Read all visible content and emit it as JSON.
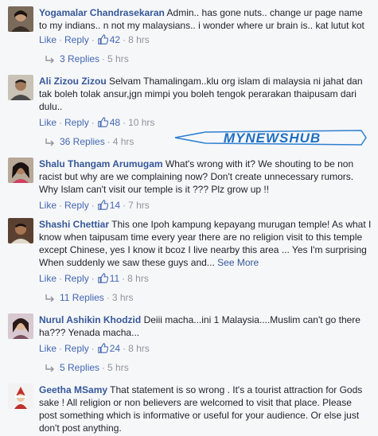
{
  "ui": {
    "like_label": "Like",
    "reply_label": "Reply",
    "like_icon": "thumbs-up-icon",
    "reply_arrow_icon": "reply-arrow-icon",
    "link_color": "#4267b2",
    "name_color": "#365899"
  },
  "watermark": {
    "text": "MYNEWSHUB"
  },
  "comments": [
    {
      "name": "Yogamalar Chandrasekaran",
      "text": "Admin.. has gone nuts.. change ur page name to my indians.. n not my malaysians.. i wonder where ur brain is.. kat lutut kot",
      "likes": "42",
      "time": "8 hrs",
      "replies": "3 Replies",
      "replies_time": "5 hrs"
    },
    {
      "name": "Ali Zizou Zizou",
      "text": "Selvam Thamalingam..klu org islam di malaysia ni jahat dan tak boleh tolak ansur,jgn mimpi you boleh tengok perarakan thaipusam dari dulu..",
      "likes": "48",
      "time": "10 hrs",
      "replies": "36 Replies",
      "replies_time": "4 hrs"
    },
    {
      "name": "Shalu Thangam Arumugam",
      "text": "What's wrong with it? We shouting to be non racist but why are we complaining now? Don't create unnecessary rumors. Why Islam can't visit our temple is it ??? Plz grow up !!",
      "likes": "14",
      "time": "7 hrs"
    },
    {
      "name": "Shashi Chettiar",
      "text": "This one Ipoh kampung kepayang murugan temple! As what I know when taipusam time every year there are no religion visit to this temple except Chinese, yes I know it bcoz I live nearby this area ... Yes I'm surprising When suddenly we saw these guys and...",
      "see_more": "See More",
      "likes": "11",
      "time": "8 hrs",
      "replies": "11 Replies",
      "replies_time": "3 hrs"
    },
    {
      "name": "Nurul Ashikin Khodzid",
      "text": "Deiii macha...ini 1 Malaysia....Muslim can't go there ha??? Yenada macha...",
      "likes": "24",
      "time": "8 hrs",
      "replies": "5 Replies",
      "replies_time": "5 hrs"
    },
    {
      "name": "Geetha MSamy",
      "text": "That statement is so wrong . It's a tourist attraction for Gods sake ! All religion or non believers are welcomed to visit that place. Please post something which is informative or useful for your audience. Or else just don't post anything."
    }
  ]
}
